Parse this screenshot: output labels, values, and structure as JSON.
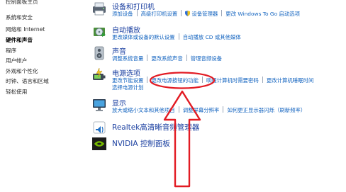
{
  "sidebar": {
    "items": [
      {
        "label": "控制面板主页"
      },
      {
        "label": "系统和安全"
      },
      {
        "label": "网络和 Internet"
      },
      {
        "label": "硬件和声音",
        "active": true
      },
      {
        "label": "程序"
      },
      {
        "label": "用户帐户"
      },
      {
        "label": "外观和个性化"
      },
      {
        "label": "时钟、语言和区域"
      },
      {
        "label": "轻松使用"
      }
    ]
  },
  "categories": {
    "devices": {
      "icon": "printer-icon",
      "title": "设备和打印机",
      "links": [
        "添加设备",
        "高级打印机设置",
        "设备管理器",
        "更改 Windows To Go 启动选项"
      ]
    },
    "autoplay": {
      "icon": "autoplay-icon",
      "title": "自动播放",
      "links": [
        "更改媒体或设备的默认设置",
        "自动播放 CD 或其他媒体"
      ]
    },
    "sound": {
      "icon": "speaker-icon",
      "title": "声音",
      "links": [
        "调整系统音量",
        "更改系统声音",
        "管理音频设备"
      ]
    },
    "power": {
      "icon": "power-options-icon",
      "title": "电源选项",
      "links": [
        "更改节能设置",
        "更改电源按钮的功能",
        "唤醒计算机时需要密码",
        "更改计算机睡眠时间"
      ],
      "links2": [
        "选择电源计划"
      ]
    },
    "display": {
      "icon": "display-icon",
      "title": "显示",
      "links": [
        "放大或缩小文本和其他项目",
        "调整屏幕分辨率",
        "如何更正显示器闪烁（刷新频率）"
      ]
    },
    "realtek": {
      "icon": "realtek-audio-icon",
      "title": "Realtek高清晰音频管理器"
    },
    "nvidia": {
      "icon": "nvidia-icon",
      "title": "NVIDIA 控制面板"
    }
  },
  "colors": {
    "link": "#1565c0",
    "title": "#1a3fa0",
    "annotation": "#e21b23"
  }
}
